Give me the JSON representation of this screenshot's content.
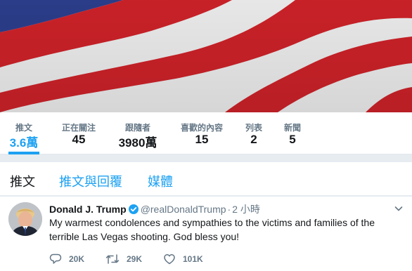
{
  "stats": [
    {
      "label": "推文",
      "value": "3.6萬",
      "active": true
    },
    {
      "label": "正在關注",
      "value": "45",
      "active": false
    },
    {
      "label": "跟隨者",
      "value": "3980萬",
      "active": false
    },
    {
      "label": "喜歡的內容",
      "value": "15",
      "active": false
    },
    {
      "label": "列表",
      "value": "2",
      "active": false
    },
    {
      "label": "新聞",
      "value": "5",
      "active": false
    }
  ],
  "tabs": [
    {
      "label": "推文",
      "active": true
    },
    {
      "label": "推文與回覆",
      "active": false
    },
    {
      "label": "媒體",
      "active": false
    }
  ],
  "tweet": {
    "name": "Donald J. Trump",
    "handle": "@realDonaldTrump",
    "separator": "·",
    "time": "2 小時",
    "text": "My warmest condolences and sympathies to the victims and families of the terrible Las Vegas shooting. God bless you!",
    "replies": "20K",
    "retweets": "29K",
    "likes": "101K",
    "icons": {
      "verified": "verified-badge-icon",
      "caret": "chevron-down-icon",
      "reply": "reply-icon",
      "retweet": "retweet-icon",
      "like": "heart-icon"
    }
  },
  "colors": {
    "accent": "#1da1f2",
    "flag_red": "#d2232a",
    "flag_blue": "#2d3f8f"
  }
}
